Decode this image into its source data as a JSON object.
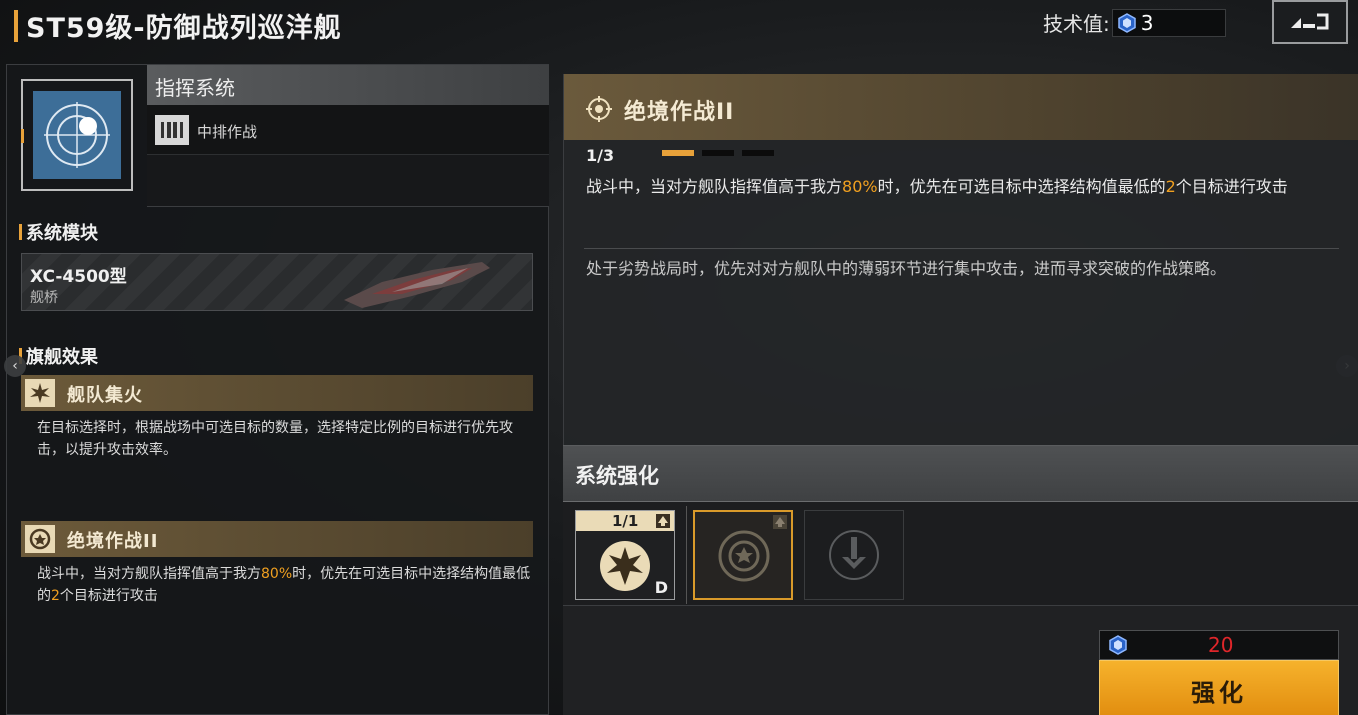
{
  "header": {
    "title": "ST59级-防御战列巡洋舰",
    "tech_label": "技术值:",
    "tech_value": "3",
    "back_icon": "return-icon"
  },
  "system": {
    "name": "指挥系统",
    "row_label": "中排作战",
    "icon": "target-icon"
  },
  "module_section": {
    "title": "系统模块",
    "module_name": "XC-4500型",
    "module_type": "舰桥"
  },
  "flagship_section": {
    "title": "旗舰效果",
    "effects": [
      {
        "name": "舰队集火",
        "icon": "burst-icon",
        "desc": "在目标选择时，根据战场中可选目标的数量，选择特定比例的目标进行优先攻击，以提升攻击效率。"
      },
      {
        "name": "绝境作战II",
        "icon": "emblem-icon",
        "desc_pre": "战斗中，当对方舰队指挥值高于我方",
        "desc_hl1": "80%",
        "desc_mid": "时，优先在可选目标中选择结构值最低的",
        "desc_hl2": "2",
        "desc_post": "个目标进行攻击"
      }
    ]
  },
  "skill_detail": {
    "name": "绝境作战II",
    "level": "1/3",
    "level_current": 1,
    "level_max": 3,
    "desc_pre": "战斗中，当对方舰队指挥值高于我方",
    "desc_hl1": "80%",
    "desc_mid": "时，优先在可选目标中选择结构值最低的",
    "desc_hl2": "2",
    "desc_post": "个目标进行攻击",
    "flavor": "处于劣势战局时，优先对对方舰队中的薄弱环节进行集中攻击，进而寻求突破的作战策略。"
  },
  "enhance": {
    "title": "系统强化",
    "slots": [
      {
        "level": "1/1",
        "grade": "D",
        "icon": "burst-icon"
      },
      {
        "icon": "emblem-icon"
      },
      {
        "icon": "anchor-icon"
      }
    ],
    "cost": "20",
    "button": "强化"
  },
  "colors": {
    "accent": "#e8a23a",
    "highlight": "#f0a020",
    "cost_red": "#e0262a"
  }
}
